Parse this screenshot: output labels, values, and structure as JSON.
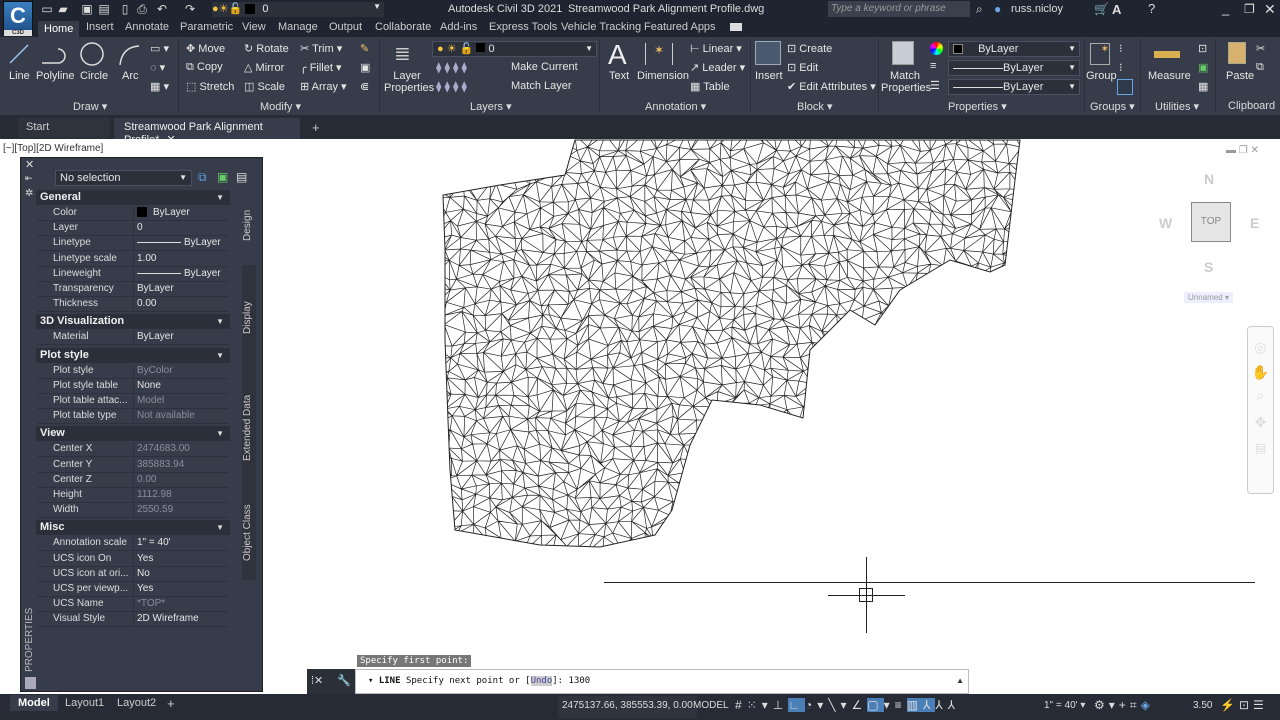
{
  "app": {
    "title": "Autodesk Civil 3D 2021",
    "file": "Streamwood Park Alignment Profile.dwg",
    "logo_sub": "C3D",
    "logo": "C"
  },
  "quick_access": {
    "layer_value": "0",
    "icons": [
      "new-icon",
      "open-icon",
      "save-icon",
      "save-as-icon",
      "share-icon",
      "plot-icon",
      "undo-icon",
      "redo-icon"
    ]
  },
  "search": {
    "placeholder": "Type a keyword or phrase"
  },
  "user": {
    "name": "russ.nicloy"
  },
  "ribbon_tabs": [
    "Home",
    "Insert",
    "Annotate",
    "Parametric",
    "View",
    "Manage",
    "Output",
    "Collaborate",
    "Add-ins",
    "Express Tools",
    "Vehicle Tracking",
    "Featured Apps"
  ],
  "active_tab": "Home",
  "ribbon": {
    "draw": {
      "title": "Draw",
      "line": "Line",
      "polyline": "Polyline",
      "circle": "Circle",
      "arc": "Arc"
    },
    "modify": {
      "title": "Modify",
      "move": "Move",
      "rotate": "Rotate",
      "trim": "Trim",
      "copy": "Copy",
      "mirror": "Mirror",
      "fillet": "Fillet",
      "stretch": "Stretch",
      "scale": "Scale",
      "array": "Array"
    },
    "layers": {
      "title": "Layers",
      "layer_properties": "Layer Properties",
      "layer_value": "0",
      "make_current": "Make Current",
      "match_layer": "Match Layer"
    },
    "annotation": {
      "title": "Annotation",
      "text": "Text",
      "dimension": "Dimension",
      "linear": "Linear",
      "leader": "Leader",
      "table": "Table"
    },
    "block": {
      "title": "Block",
      "insert": "Insert",
      "create": "Create",
      "edit": "Edit",
      "edit_attributes": "Edit Attributes"
    },
    "properties": {
      "title": "Properties",
      "match_properties": "Match Properties",
      "color": "ByLayer",
      "linetype": "ByLayer",
      "lineweight": "ByLayer"
    },
    "groups": {
      "title": "Groups",
      "group": "Group"
    },
    "utilities": {
      "title": "Utilities",
      "measure": "Measure"
    },
    "clipboard": {
      "title": "Clipboard",
      "paste": "Paste"
    }
  },
  "doc_tabs": {
    "start": "Start",
    "active": "Streamwood Park Alignment Profile*",
    "add": "+"
  },
  "viewport": {
    "label": "[−][Top][2D Wireframe]"
  },
  "viewcube": {
    "n": "N",
    "s": "S",
    "e": "E",
    "w": "W",
    "face": "TOP",
    "ucs": "Unnamed"
  },
  "properties_palette": {
    "title": "PROPERTIES",
    "selection": "No selection",
    "side_tabs": [
      "Design",
      "Display",
      "Extended Data",
      "Object Class"
    ],
    "sections": [
      {
        "name": "General",
        "rows": [
          [
            "Color",
            "ByLayer"
          ],
          [
            "Layer",
            "0"
          ],
          [
            "Linetype",
            "ByLayer"
          ],
          [
            "Linetype scale",
            "1.00"
          ],
          [
            "Lineweight",
            "ByLayer"
          ],
          [
            "Transparency",
            "ByLayer"
          ],
          [
            "Thickness",
            "0.00"
          ]
        ]
      },
      {
        "name": "3D Visualization",
        "rows": [
          [
            "Material",
            "ByLayer"
          ]
        ]
      },
      {
        "name": "Plot style",
        "rows": [
          [
            "Plot style",
            "ByColor"
          ],
          [
            "Plot style table",
            "None"
          ],
          [
            "Plot table attac...",
            "Model"
          ],
          [
            "Plot table type",
            "Not available"
          ]
        ]
      },
      {
        "name": "View",
        "rows": [
          [
            "Center X",
            "2474683.00"
          ],
          [
            "Center Y",
            "385883.94"
          ],
          [
            "Center Z",
            "0.00"
          ],
          [
            "Height",
            "1112.98"
          ],
          [
            "Width",
            "2550.59"
          ]
        ]
      },
      {
        "name": "Misc",
        "rows": [
          [
            "Annotation scale",
            "1\" = 40'"
          ],
          [
            "UCS icon On",
            "Yes"
          ],
          [
            "UCS icon at ori...",
            "No"
          ],
          [
            "UCS per viewp...",
            "Yes"
          ],
          [
            "UCS Name",
            "*TOP*"
          ],
          [
            "Visual Style",
            "2D Wireframe"
          ]
        ]
      }
    ]
  },
  "command": {
    "history": "Specify first point:",
    "prompt_cmd": "LINE",
    "prompt": "Specify next point or [",
    "option": "Undo",
    "prompt_end": "]: ",
    "input": "1300"
  },
  "layout_tabs": [
    "Model",
    "Layout1",
    "Layout2",
    "+"
  ],
  "status": {
    "coords": "2475137.66, 385553.39, 0.00",
    "space": "MODEL",
    "anno_scale": "1\" = 40'",
    "value": "3.50"
  }
}
